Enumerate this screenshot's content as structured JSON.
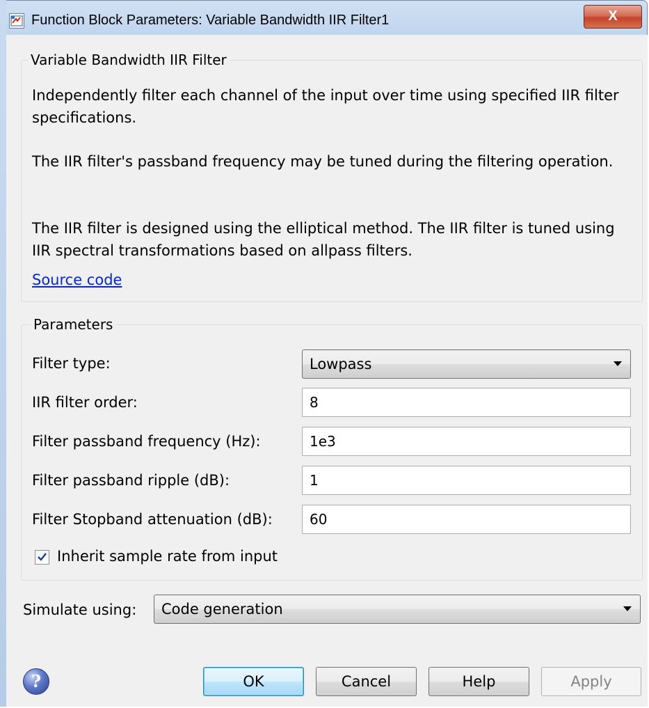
{
  "window": {
    "title": "Function Block Parameters: Variable Bandwidth IIR Filter1",
    "close_glyph": "X"
  },
  "description_group": {
    "legend": "Variable Bandwidth IIR Filter",
    "paragraphs": [
      "Independently filter each channel of the input over time using specified IIR filter specifications.",
      "The IIR filter's passband frequency may be tuned during the filtering operation.",
      "The IIR filter is designed using the elliptical method. The IIR filter is tuned using IIR spectral transformations based on allpass filters."
    ],
    "link": "Source code"
  },
  "parameters": {
    "legend": "Parameters",
    "filter_type": {
      "label": "Filter type:",
      "value": "Lowpass"
    },
    "filter_order": {
      "label": "IIR filter order:",
      "value": "8"
    },
    "passband_frequency": {
      "label": "Filter passband frequency (Hz):",
      "value": "1e3"
    },
    "passband_ripple": {
      "label": "Filter passband ripple (dB):",
      "value": "1"
    },
    "stopband_attenuation": {
      "label": "Filter Stopband attenuation (dB):",
      "value": "60"
    },
    "inherit_sample_rate": {
      "label": "Inherit sample rate from input",
      "checked": true
    }
  },
  "simulate": {
    "label": "Simulate using:",
    "value": "Code generation"
  },
  "buttons": {
    "help_icon": "?",
    "ok": "OK",
    "cancel": "Cancel",
    "help": "Help",
    "apply": "Apply"
  },
  "colors": {
    "link": "#0026e5",
    "close_button": "#c4432a",
    "title_bar": "#bcd3ee"
  }
}
